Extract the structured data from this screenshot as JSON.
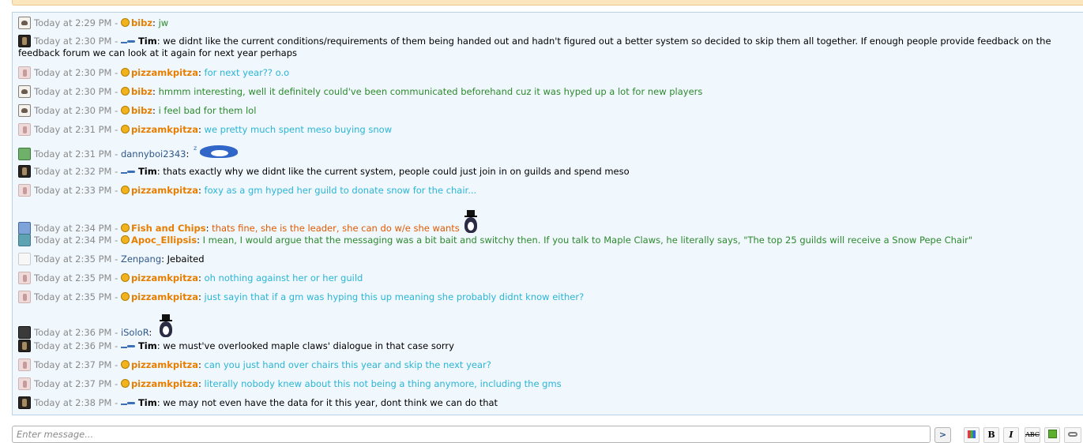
{
  "messages": [
    {
      "avatar": "bibz-avatar",
      "time": "Today at 2:29 PM - ",
      "badge": true,
      "name": "bibz",
      "sep": ": ",
      "text": "jw",
      "name_color": "orange",
      "text_color": "green"
    },
    {
      "avatar": "tim-avatar",
      "time": "Today at 2:30 PM - ",
      "role": true,
      "name": "Tim",
      "sep": ": ",
      "text": "we didnt like the current conditions/requirements of them being handed out and hadn't figured out a better system so decided to skip them all together. If enough people provide feedback on the feedback forum we can look at it again for next year perhaps",
      "name_color": "black",
      "text_color": "black"
    },
    {
      "avatar": "pizza-avatar",
      "time": "Today at 2:30 PM - ",
      "badge": true,
      "name": "pizzamkpitza",
      "sep": ": ",
      "text": "for next year?? o.o",
      "name_color": "orange",
      "text_color": "cyan"
    },
    {
      "avatar": "bibz-avatar",
      "time": "Today at 2:30 PM - ",
      "badge": true,
      "name": "bibz",
      "sep": ": ",
      "text": "hmmm interesting, well it definitely could've been communicated beforehand cuz it was hyped up a lot for new players",
      "name_color": "orange",
      "text_color": "green"
    },
    {
      "avatar": "bibz-avatar",
      "time": "Today at 2:30 PM - ",
      "badge": true,
      "name": "bibz",
      "sep": ": ",
      "text": "i feel bad for them lol",
      "name_color": "orange",
      "text_color": "green"
    },
    {
      "avatar": "pizza-avatar",
      "time": "Today at 2:31 PM - ",
      "badge": true,
      "name": "pizzamkpitza",
      "sep": ": ",
      "text": "we pretty much spent meso buying snow",
      "name_color": "orange",
      "text_color": "cyan"
    },
    {
      "avatar": "danny-avatar",
      "time": "Today at 2:31 PM - ",
      "name": "dannyboi2343",
      "sep": ": ",
      "text": "",
      "sticker": "sleeping-penguin",
      "name_color": "blue",
      "text_color": "black"
    },
    {
      "avatar": "tim-avatar",
      "time": "Today at 2:32 PM - ",
      "role": true,
      "name": "Tim",
      "sep": ": ",
      "text": "thats exactly why we didnt like the current system, people could just join in on guilds and spend meso",
      "name_color": "black",
      "text_color": "black"
    },
    {
      "avatar": "pizza-avatar",
      "time": "Today at 2:33 PM - ",
      "badge": true,
      "name": "pizzamkpitza",
      "sep": ": ",
      "text": "foxy as a gm hyped her guild to donate snow for the chair...",
      "name_color": "orange",
      "text_color": "cyan"
    },
    {
      "avatar": "fish-avatar",
      "time": "Today at 2:34 PM - ",
      "badge": true,
      "name": "Fish and Chips",
      "sep": ": ",
      "text": "thats fine, she is the leader, she can do w/e she wants",
      "sticker": "tophat-penguin",
      "name_color": "orange",
      "text_color": "orange"
    },
    {
      "avatar": "apoc-avatar",
      "time": "Today at 2:34 PM - ",
      "badge": true,
      "name": "Apoc_Ellipsis",
      "sep": ": ",
      "text": "I mean, I would argue that the messaging was a bit bait and switchy then. If you talk to Maple Claws, he literally says, \"The top 25 guilds will receive a Snow Pepe Chair\"",
      "name_color": "orange",
      "text_color": "green"
    },
    {
      "avatar": "zen-avatar",
      "time": "Today at 2:35 PM - ",
      "name": "Zenpang",
      "sep": ": ",
      "text": "Jebaited",
      "name_color": "blue",
      "text_color": "black"
    },
    {
      "avatar": "pizza-avatar",
      "time": "Today at 2:35 PM - ",
      "badge": true,
      "name": "pizzamkpitza",
      "sep": ": ",
      "text": "oh nothing against her or her guild",
      "name_color": "orange",
      "text_color": "cyan"
    },
    {
      "avatar": "pizza-avatar",
      "time": "Today at 2:35 PM - ",
      "badge": true,
      "name": "pizzamkpitza",
      "sep": ": ",
      "text": "just sayin that if a gm was hyping this up meaning she probably didnt know either?",
      "name_color": "orange",
      "text_color": "cyan"
    },
    {
      "avatar": "isolo-avatar",
      "time": "Today at 2:36 PM - ",
      "name": "iSoloR",
      "sep": ": ",
      "text": "",
      "sticker": "tophat-penguin",
      "name_color": "blue",
      "text_color": "black"
    },
    {
      "avatar": "tim-avatar",
      "time": "Today at 2:36 PM - ",
      "role": true,
      "name": "Tim",
      "sep": ": ",
      "text": "we must've overlooked maple claws' dialogue in that case sorry",
      "name_color": "black",
      "text_color": "black"
    },
    {
      "avatar": "pizza-avatar",
      "time": "Today at 2:37 PM - ",
      "badge": true,
      "name": "pizzamkpitza",
      "sep": ": ",
      "text": "can you just hand over chairs this year and skip the next year?",
      "name_color": "orange",
      "text_color": "cyan"
    },
    {
      "avatar": "pizza-avatar",
      "time": "Today at 2:37 PM - ",
      "badge": true,
      "name": "pizzamkpitza",
      "sep": ": ",
      "text": "literally nobody knew about this not being a thing anymore, including the gms",
      "name_color": "orange",
      "text_color": "cyan"
    },
    {
      "avatar": "tim-avatar",
      "time": "Today at 2:38 PM - ",
      "role": true,
      "name": "Tim",
      "sep": ": ",
      "text": "we may not even have the data for it this year, dont think we can do that",
      "name_color": "black",
      "text_color": "black"
    }
  ],
  "composer": {
    "placeholder": "Enter message...",
    "send_label": ">",
    "bold_label": "B",
    "italic_label": "I",
    "strike_label": "ABC"
  },
  "colors": {
    "name_orange": "#e67e00",
    "text_green": "#2d8a2d",
    "text_cyan": "#2bb5d6",
    "text_orange": "#e05a00",
    "name_blue": "#30588a",
    "panel_bg": "#f0f7fd"
  }
}
